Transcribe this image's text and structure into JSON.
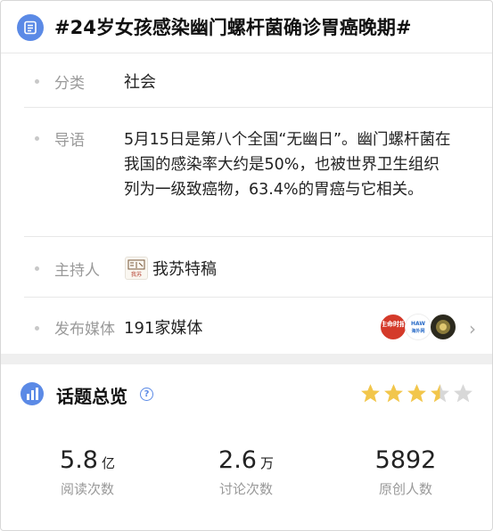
{
  "header": {
    "title": "#24岁女孩感染幽门螺杆菌确诊胃癌晚期#",
    "icon": "document-icon"
  },
  "details": {
    "category": {
      "label": "分类",
      "value": "社会"
    },
    "intro": {
      "label": "导语",
      "text": "5月15日是第八个全国“无幽日”。幽门螺杆菌在我国的感染率大约是50%，也被世界卫生组织列为一级致癌物，63.4%的胃癌与它相关。"
    },
    "host": {
      "label": "主持人",
      "value": "我苏特稿",
      "logo_text": "我苏"
    },
    "media": {
      "label": "发布媒体",
      "value": "191家媒体",
      "logos": [
        {
          "name": "生命时报",
          "color": "#d43a2a"
        },
        {
          "name": "海外网",
          "color": "#ffffff"
        },
        {
          "name": "media-avatar",
          "color": "#2c2a1e"
        }
      ]
    }
  },
  "overview": {
    "title": "话题总览",
    "rating": 3.5,
    "rating_max": 5,
    "stats": [
      {
        "value": "5.8",
        "unit": "亿",
        "caption": "阅读次数"
      },
      {
        "value": "2.6",
        "unit": "万",
        "caption": "讨论次数"
      },
      {
        "value": "5892",
        "unit": "",
        "caption": "原创人数"
      }
    ]
  },
  "colors": {
    "accent": "#5b8ae6",
    "star_on": "#f2c64b",
    "star_off": "#d8d8d8",
    "label": "#9a9a9a"
  }
}
